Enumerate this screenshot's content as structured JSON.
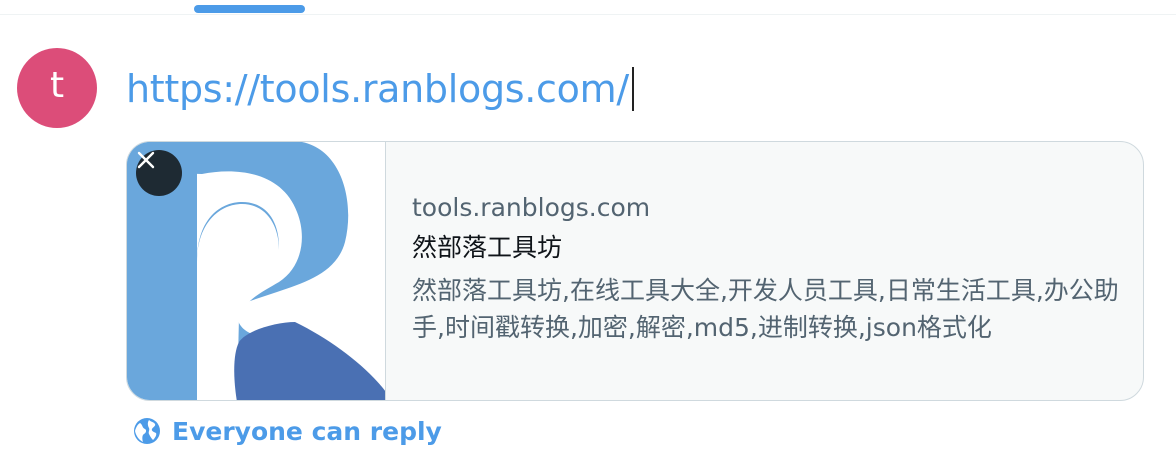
{
  "compose": {
    "text": "https://tools.ranblogs.com/"
  },
  "avatar": {
    "initial": "t",
    "color": "#dc4d79"
  },
  "link_card": {
    "domain": "tools.ranblogs.com",
    "title": "然部落工具坊",
    "description": "然部落工具坊,在线工具大全,开发人员工具,日常生活工具,办公助手,时间戳转换,加密,解密,md5,进制转换,json格式化",
    "remove_icon": "close-icon",
    "image_icon": "ranblogs-logo"
  },
  "reply_setting": {
    "label": "Everyone can reply",
    "icon": "globe-icon"
  },
  "colors": {
    "accent": "#4c9be8",
    "logo_light": "#6aa7dc",
    "logo_dark": "#4a70b3"
  }
}
